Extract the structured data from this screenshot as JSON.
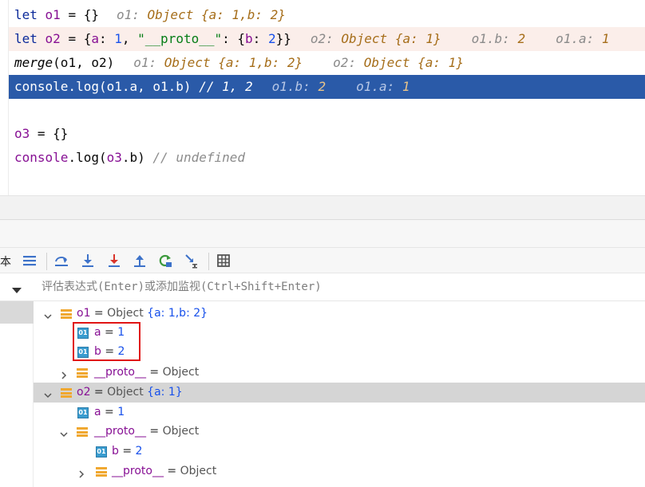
{
  "editor": {
    "line1": {
      "code_let": "let",
      "code_var": "o1",
      "code_rest": " = {}",
      "hint_name": "o1:",
      "hint_val": "Object {a: 1,b: 2}"
    },
    "line2": {
      "code_let": "let",
      "code_var": "o2",
      "code_eq": " = {",
      "k_a": "a",
      "colon1": ": ",
      "v_a": "1",
      "comma1": ", ",
      "proto_str": "\"__proto__\"",
      "colon2": ": {",
      "k_b": "b",
      "colon3": ": ",
      "v_b": "2",
      "close": "}}",
      "hint1_name": "o2:",
      "hint1_val": "Object {a: 1}",
      "hint2_name": "o1.b:",
      "hint2_val": "2",
      "hint3_name": "o1.a:",
      "hint3_val": "1"
    },
    "line3": {
      "fn": "merge",
      "args": "(o1, o2)",
      "hint1_name": "o1:",
      "hint1_val": "Object {a: 1,b: 2}",
      "hint2_name": "o2:",
      "hint2_val": "Object {a: 1}"
    },
    "line4": {
      "code": "console.log(o1.a, o1.b)",
      "comment": "// 1, 2",
      "hint1_name": "o1.b:",
      "hint1_val": "2",
      "hint2_name": "o1.a:",
      "hint2_val": "1"
    },
    "line6": {
      "var": "o3",
      "rest": " = {}"
    },
    "line7": {
      "obj": "console",
      "rest1": ".log(",
      "var": "o3",
      "rest2": ".b)",
      "comment": "// undefined"
    }
  },
  "toolbar": {
    "partial_label": "本",
    "icons": [
      "frames-menu-icon",
      "step-over-icon",
      "step-into-icon",
      "force-step-into-icon",
      "step-out-icon",
      "reset-frame-icon",
      "run-to-cursor-icon",
      "evaluate-table-icon"
    ]
  },
  "evaluate": {
    "placeholder": "评估表达式(Enter)或添加监视(Ctrl+Shift+Enter)"
  },
  "variables": {
    "o1": {
      "name": "o1",
      "eq": " = ",
      "type": "Object ",
      "val": "{a: 1,b: 2}"
    },
    "o1_a": {
      "name": "a",
      "eq": " = ",
      "val": "1"
    },
    "o1_b": {
      "name": "b",
      "eq": " = ",
      "val": "2"
    },
    "o1_proto": {
      "name": "__proto__",
      "eq": " = ",
      "type": "Object"
    },
    "o2": {
      "name": "o2",
      "eq": " = ",
      "type": "Object ",
      "val": "{a: 1}"
    },
    "o2_a": {
      "name": "a",
      "eq": " = ",
      "val": "1"
    },
    "o2_proto": {
      "name": "__proto__",
      "eq": " = ",
      "type": "Object"
    },
    "o2_proto_b": {
      "name": "b",
      "eq": " = ",
      "val": "2"
    },
    "o2_proto_proto": {
      "name": "__proto__",
      "eq": " = ",
      "type": "Object"
    },
    "field_badge": "01"
  },
  "colors": {
    "selected_line": "#2a5aa8",
    "highlight_line": "#fbeeea",
    "annotation_box": "#e01414"
  }
}
